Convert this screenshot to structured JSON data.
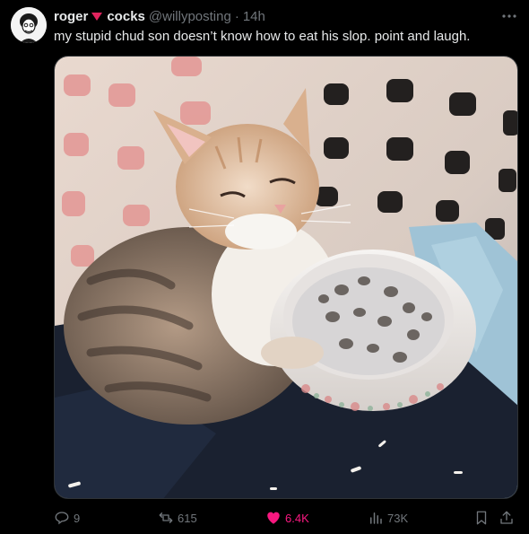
{
  "tweet": {
    "display_name_first": "roger",
    "display_name_second": "cocks",
    "handle": "@willyposting",
    "separator": "·",
    "time": "14h",
    "text": "my stupid chud son doesn’t know how to eat his slop. point and laugh.",
    "media_icon": "kitten-with-milk-bowl-photo"
  },
  "actions": {
    "replies": "9",
    "reposts": "615",
    "likes": "6.4K",
    "views": "73K",
    "liked": true
  },
  "colors": {
    "background": "#000000",
    "text": "#e7e9ea",
    "muted": "#71767b",
    "like": "#f91880",
    "heart_emoji": "#e0245e"
  },
  "icons": {
    "more": "more-horizontal-icon",
    "reply": "reply-icon",
    "repost": "repost-icon",
    "like": "heart-filled-icon",
    "views": "views-bar-chart-icon",
    "bookmark": "bookmark-icon",
    "share": "share-icon"
  }
}
